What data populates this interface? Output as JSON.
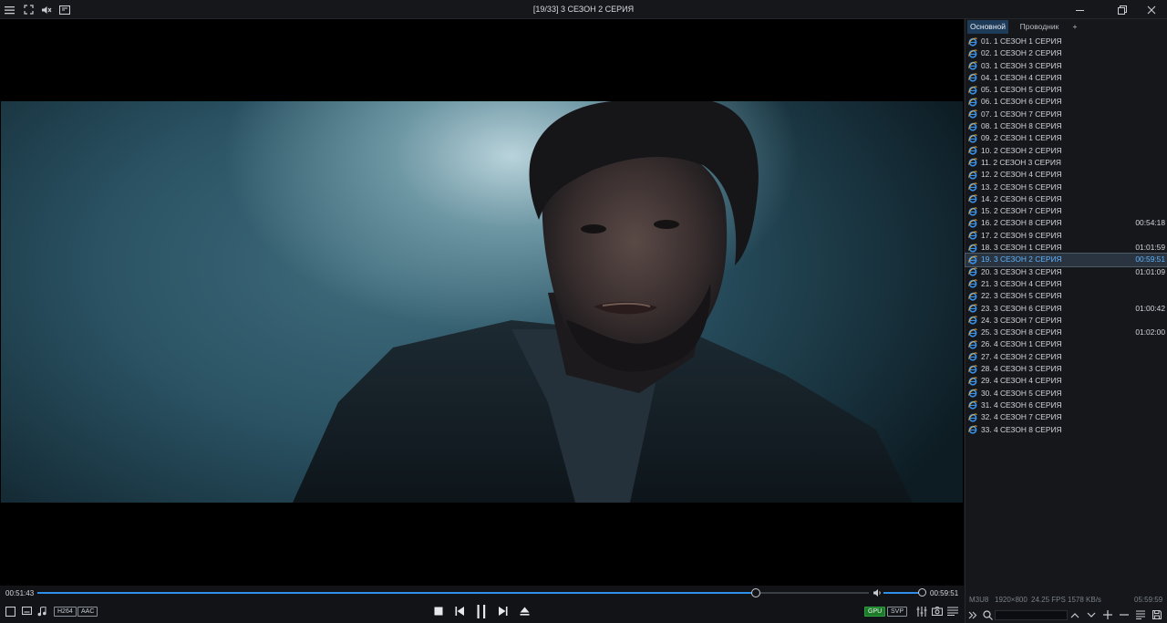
{
  "window": {
    "title": "[19/33]  3 СЕЗОН 2 СЕРИЯ",
    "controls": [
      "minimize",
      "restore",
      "close"
    ]
  },
  "panel": {
    "tabs": [
      {
        "label": "Основной",
        "active": true
      },
      {
        "label": "Проводник",
        "active": false
      },
      {
        "label": "+",
        "active": false
      }
    ],
    "items": [
      {
        "label": "01.  1 СЕЗОН 1 СЕРИЯ",
        "duration": ""
      },
      {
        "label": "02.  1 СЕЗОН 2 СЕРИЯ",
        "duration": ""
      },
      {
        "label": "03.  1 СЕЗОН 3 СЕРИЯ",
        "duration": ""
      },
      {
        "label": "04.  1 СЕЗОН 4 СЕРИЯ",
        "duration": ""
      },
      {
        "label": "05.  1 СЕЗОН 5 СЕРИЯ",
        "duration": ""
      },
      {
        "label": "06.  1 СЕЗОН 6 СЕРИЯ",
        "duration": ""
      },
      {
        "label": "07.  1 СЕЗОН 7 СЕРИЯ",
        "duration": ""
      },
      {
        "label": "08.  1 СЕЗОН 8 СЕРИЯ",
        "duration": ""
      },
      {
        "label": "09.  2 СЕЗОН 1 СЕРИЯ",
        "duration": ""
      },
      {
        "label": "10.  2 СЕЗОН 2 СЕРИЯ",
        "duration": ""
      },
      {
        "label": "11.  2 СЕЗОН 3 СЕРИЯ",
        "duration": ""
      },
      {
        "label": "12.  2 СЕЗОН 4 СЕРИЯ",
        "duration": ""
      },
      {
        "label": "13.  2 СЕЗОН 5 СЕРИЯ",
        "duration": ""
      },
      {
        "label": "14.  2 СЕЗОН 6 СЕРИЯ",
        "duration": ""
      },
      {
        "label": "15.  2 СЕЗОН 7 СЕРИЯ",
        "duration": ""
      },
      {
        "label": "16.  2 СЕЗОН 8 СЕРИЯ",
        "duration": "00:54:18"
      },
      {
        "label": "17.  2 СЕЗОН 9 СЕРИЯ",
        "duration": ""
      },
      {
        "label": "18.  3 СЕЗОН 1 СЕРИЯ",
        "duration": "01:01:59"
      },
      {
        "label": "19.  3 СЕЗОН 2 СЕРИЯ",
        "duration": "00:59:51",
        "selected": true
      },
      {
        "label": "20.  3 СЕЗОН 3 СЕРИЯ",
        "duration": "01:01:09"
      },
      {
        "label": "21.  3 СЕЗОН 4 СЕРИЯ",
        "duration": ""
      },
      {
        "label": "22.  3 СЕЗОН 5 СЕРИЯ",
        "duration": ""
      },
      {
        "label": "23.  3 СЕЗОН 6 СЕРИЯ",
        "duration": "01:00:42"
      },
      {
        "label": "24.  3 СЕЗОН 7 СЕРИЯ",
        "duration": ""
      },
      {
        "label": "25.  3 СЕЗОН 8 СЕРИЯ",
        "duration": "01:02:00"
      },
      {
        "label": "26.  4 СЕЗОН 1 СЕРИЯ",
        "duration": ""
      },
      {
        "label": "27.  4 СЕЗОН 2 СЕРИЯ",
        "duration": ""
      },
      {
        "label": "28.  4 СЕЗОН 3 СЕРИЯ",
        "duration": ""
      },
      {
        "label": "29.  4 СЕЗОН 4 СЕРИЯ",
        "duration": ""
      },
      {
        "label": "30.  4 СЕЗОН 5 СЕРИЯ",
        "duration": ""
      },
      {
        "label": "31.  4 СЕЗОН 6 СЕРИЯ",
        "duration": ""
      },
      {
        "label": "32.  4 СЕЗОН 7 СЕРИЯ",
        "duration": ""
      },
      {
        "label": "33.  4 СЕЗОН 8 СЕРИЯ",
        "duration": ""
      }
    ],
    "status": {
      "format": "M3U8",
      "resolution": "1920×800",
      "fps": "24.25 FPS",
      "bitrate": "1578 KB/s",
      "total_time": "05:59:59"
    }
  },
  "playback": {
    "elapsed": "00:51:43",
    "duration": "00:59:51",
    "progress": 0.864,
    "volume": 1.0
  },
  "controls": {
    "video_codec": "H264",
    "audio_codec": "AAC",
    "gpu_label": "GPU",
    "svp_label": "SVP"
  },
  "colors": {
    "accent": "#2f8ee8",
    "selected_text": "#5fb4ff",
    "active_tab": "#1e3b5a",
    "gpu_badge": "#1d7a2a"
  },
  "icons": {
    "titlebar": [
      "menu-icon",
      "fullscreen-icon",
      "volume-mute-icon",
      "playlist-toggle-icon"
    ],
    "item": "internet-explorer-icon"
  }
}
